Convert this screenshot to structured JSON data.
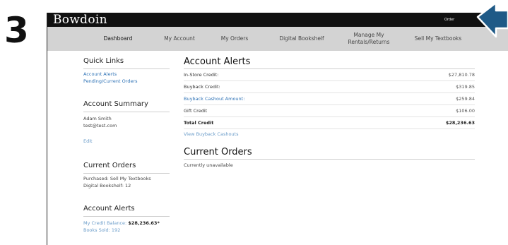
{
  "step_number": "3",
  "header": {
    "logo": "Bowdoin",
    "order_link": "Order"
  },
  "nav": {
    "items": [
      "Dashboard",
      "My Account",
      "My Orders",
      "Digital Bookshelf",
      "Manage My\nRentals/Returns",
      "Sell My Textbooks"
    ]
  },
  "sidebar": {
    "quick_links": {
      "title": "Quick Links",
      "links": [
        "Account Alerts",
        "Pending/Current Orders"
      ]
    },
    "account_summary": {
      "title": "Account Summary",
      "name": "Adam Smith",
      "email": "test@test.com",
      "edit": "Edit"
    },
    "current_orders": {
      "title": "Current Orders",
      "purchased": "Purchased: Sell My Textbooks",
      "bookshelf": "Digital Bookshelf: 12"
    },
    "account_alerts": {
      "title": "Account Alerts",
      "credit_label": "My Credit Balance:",
      "credit_value": "$28,236.63*",
      "books_sold": "Books Sold: 192"
    }
  },
  "main": {
    "alerts_title": "Account Alerts",
    "rows": [
      {
        "label": "In-Store Credit:",
        "value": "$27,810.78"
      },
      {
        "label": "Buyback Credit:",
        "value": "$319.85"
      },
      {
        "label": "Buyback Cashout Amount:",
        "value": "$259.84"
      },
      {
        "label": "Gift Credit",
        "value": "$106.00"
      },
      {
        "label": "Total Credit",
        "value": "$28,236.63"
      }
    ],
    "view_cashouts": "View Buyback Cashouts",
    "orders_title": "Current Orders",
    "orders_status": "Currently unavailable"
  },
  "colors": {
    "link": "#2f73b6",
    "arrow_fill": "#1f5a87",
    "nav_bg": "#d3d3d3",
    "topbar_bg": "#111111"
  }
}
